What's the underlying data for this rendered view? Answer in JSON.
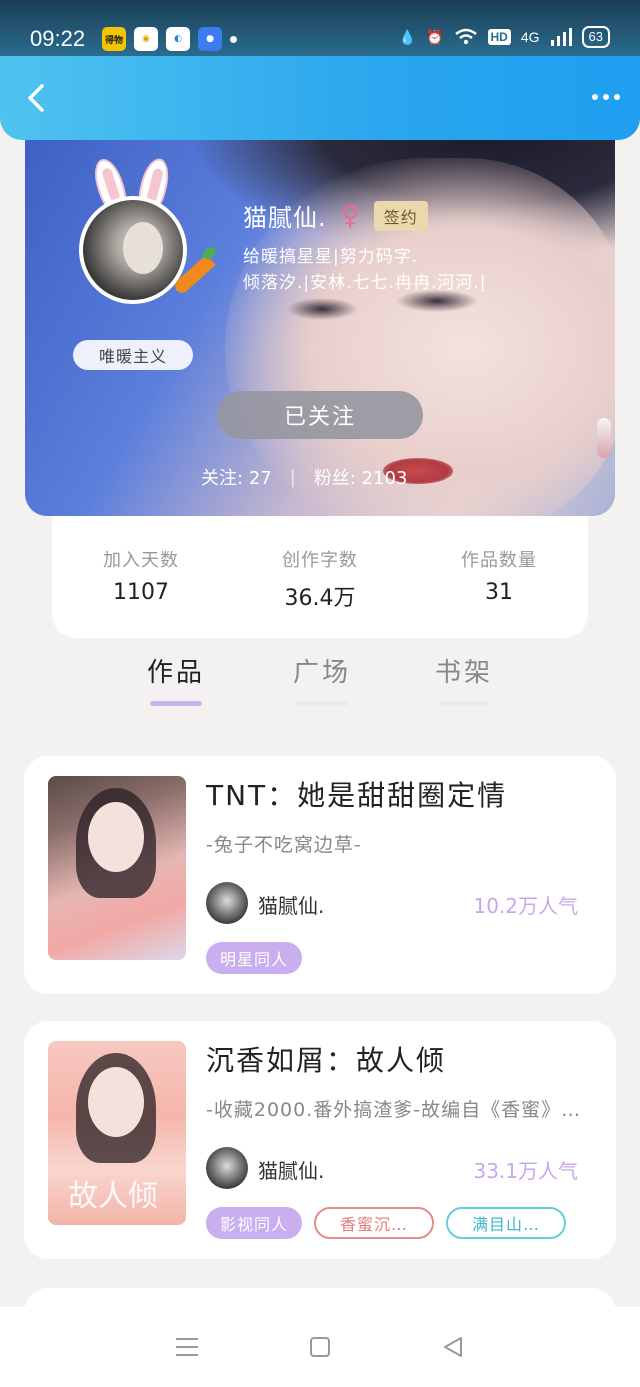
{
  "status_bar": {
    "time": "09:22",
    "apps": [
      "得物",
      "",
      "",
      ""
    ],
    "network": "4G",
    "hd": "HD",
    "battery": "63"
  },
  "colors": {
    "app_bar_accent": "#2aa6ee",
    "tab_underline_active": "#c9b4ee",
    "popularity": "#c6a8ec",
    "gender_female": "#f06a96"
  },
  "profile": {
    "nickname": "猫腻仙.",
    "gender_icon": "female-symbol-icon",
    "gender_symbol": "♀",
    "signed_badge": "签约",
    "bio_line1": "给暖搞星星|努力码字.",
    "bio_line2": "倾落汐.|安林.七七.冉冉.河河.|",
    "motto": "唯暖主义",
    "follow_button": "已关注",
    "following_label": "关注:",
    "following_count": "27",
    "divider": "|",
    "fans_label": "粉丝:",
    "fans_count": "2103"
  },
  "stats": [
    {
      "label": "加入天数",
      "value": "1107"
    },
    {
      "label": "创作字数",
      "value": "36.4万"
    },
    {
      "label": "作品数量",
      "value": "31"
    }
  ],
  "tabs": [
    {
      "label": "作品",
      "active": true
    },
    {
      "label": "广场",
      "active": false
    },
    {
      "label": "书架",
      "active": false
    }
  ],
  "books": [
    {
      "title": "TNT：她是甜甜圈定情",
      "subtitle": "-兔子不吃窝边草-",
      "author": "猫腻仙.",
      "popularity": "10.2万人气",
      "tags": [
        "明星同人"
      ]
    },
    {
      "title": "沉香如屑：故人倾",
      "subtitle": "-收藏2000.番外搞渣爹-故编自《香蜜》…",
      "author": "猫腻仙.",
      "popularity": "33.1万人气",
      "cover_text": "故人倾",
      "tags": [
        "影视同人",
        "香蜜沉…",
        "满目山…"
      ]
    }
  ]
}
